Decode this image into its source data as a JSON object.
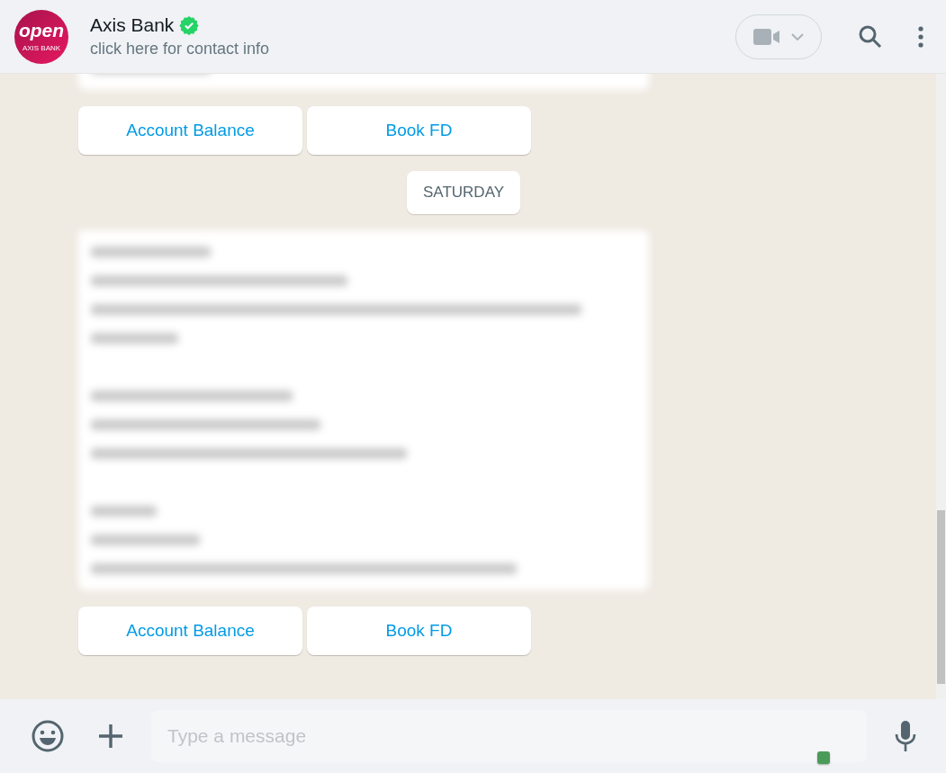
{
  "header": {
    "avatar": {
      "wordmark": "open",
      "caption": "AXIS BANK"
    },
    "name": "Axis Bank",
    "verified": true,
    "subtitle": "click here for contact info"
  },
  "messages": [
    {
      "kind": "cutoff"
    },
    {
      "kind": "buttons",
      "labels": [
        "Account Balance",
        "Book FD"
      ]
    },
    {
      "kind": "date",
      "label": "SATURDAY"
    },
    {
      "kind": "blurred"
    },
    {
      "kind": "buttons",
      "labels": [
        "Account Balance",
        "Book FD"
      ]
    }
  ],
  "composer": {
    "placeholder": "Type a message"
  }
}
